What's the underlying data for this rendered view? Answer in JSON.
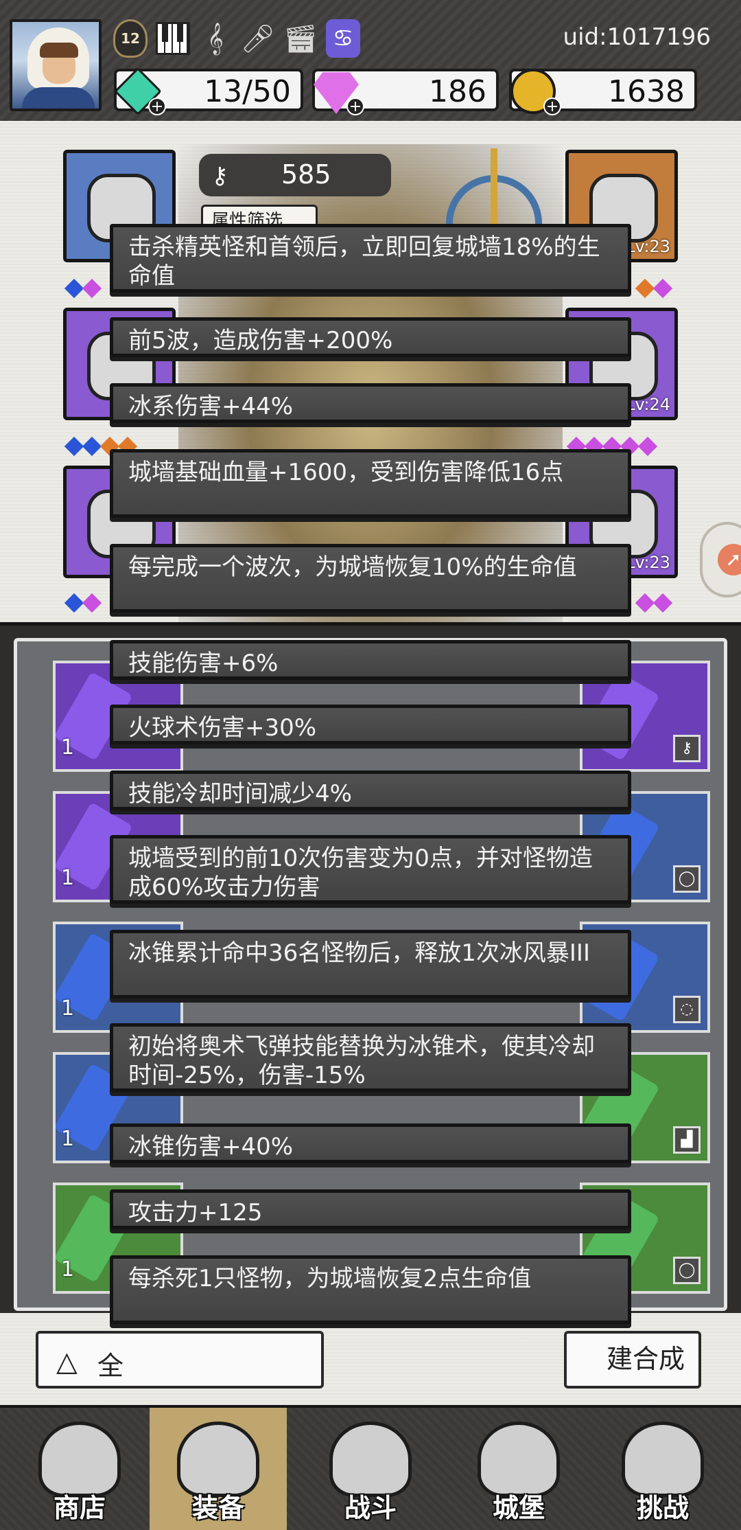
{
  "header": {
    "uid": "uid:1017196",
    "level": "12",
    "energy": "13/50",
    "gems": "186",
    "coins": "1638",
    "badge_icons": [
      "level-badge-icon",
      "piano-icon",
      "music-note-icon",
      "microphone-icon",
      "clapper-icon",
      "cancer-zodiac-icon"
    ]
  },
  "equipment": {
    "key_count": "585",
    "filter_label": "属性筛选",
    "slot_levels": [
      "Lv:23",
      "Lv:24",
      "Lv:23"
    ]
  },
  "tooltips": [
    "击杀精英怪和首领后，立即回复城墙18%的生命值",
    "前5波，造成伤害+200%",
    "冰系伤害+44%",
    "城墙基础血量+1600，受到伤害降低16点",
    "每完成一个波次，为城墙恢复10%的生命值",
    "技能伤害+6%",
    "火球术伤害+30%",
    "技能冷却时间减少4%",
    "城墙受到的前10次伤害变为0点，并对怪物造成60%攻击力伤害",
    "冰锥累计命中36名怪物后，释放1次冰风暴III",
    "初始将奥术飞弹技能替换为冰锥术，使其冷却时间-25%，伤害-15%",
    "冰锥伤害+40%",
    "攻击力+125",
    "每杀死1只怪物，为城墙恢复2点生命值"
  ],
  "inventory": {
    "count_label": "1"
  },
  "actions": {
    "all_label": "全",
    "merge_label": "建合成"
  },
  "nav": [
    {
      "label": "商店",
      "icon": "shop-icon"
    },
    {
      "label": "装备",
      "icon": "backpack-icon"
    },
    {
      "label": "战斗",
      "icon": "crossed-swords-icon"
    },
    {
      "label": "城堡",
      "icon": "castle-icon"
    },
    {
      "label": "挑战",
      "icon": "shield-icon"
    }
  ],
  "colors": {
    "tooltip_bg": "#474747",
    "paper": "#ecebe6",
    "nav_active": "#bfa56e"
  }
}
